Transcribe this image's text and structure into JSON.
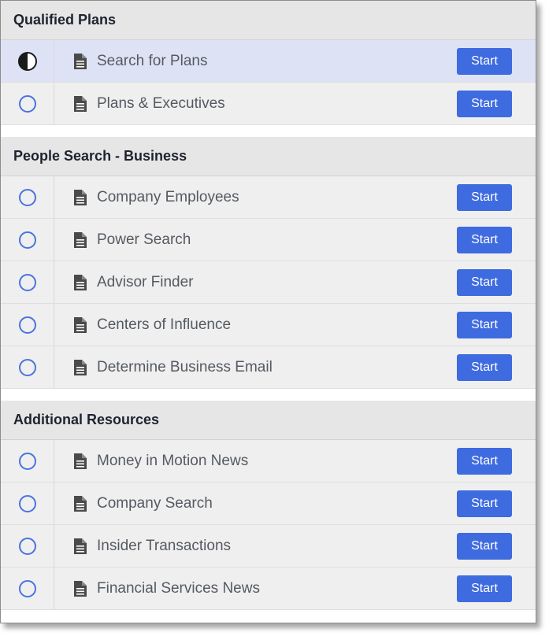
{
  "sections": [
    {
      "title": "Qualified Plans",
      "items": [
        {
          "label": "Search for Plans",
          "status": "in-progress",
          "button": "Start"
        },
        {
          "label": "Plans & Executives",
          "status": "not-started",
          "button": "Start"
        }
      ]
    },
    {
      "title": "People Search - Business",
      "items": [
        {
          "label": "Company Employees",
          "status": "not-started",
          "button": "Start"
        },
        {
          "label": "Power Search",
          "status": "not-started",
          "button": "Start"
        },
        {
          "label": "Advisor Finder",
          "status": "not-started",
          "button": "Start"
        },
        {
          "label": "Centers of Influence",
          "status": "not-started",
          "button": "Start"
        },
        {
          "label": "Determine Business Email",
          "status": "not-started",
          "button": "Start"
        }
      ]
    },
    {
      "title": "Additional Resources",
      "items": [
        {
          "label": "Money in Motion News",
          "status": "not-started",
          "button": "Start"
        },
        {
          "label": "Company Search",
          "status": "not-started",
          "button": "Start"
        },
        {
          "label": "Insider Transactions",
          "status": "not-started",
          "button": "Start"
        },
        {
          "label": "Financial Services News",
          "status": "not-started",
          "button": "Start"
        }
      ]
    }
  ],
  "colors": {
    "accent": "#3f6be0",
    "circle": "#4a72e0",
    "active_row": "#dde3f4",
    "header_bg": "#e6e6e6",
    "row_bg": "#efefef"
  },
  "icons": {
    "item": "document-icon",
    "status_in_progress": "half-circle-icon",
    "status_not_started": "empty-circle-icon"
  }
}
